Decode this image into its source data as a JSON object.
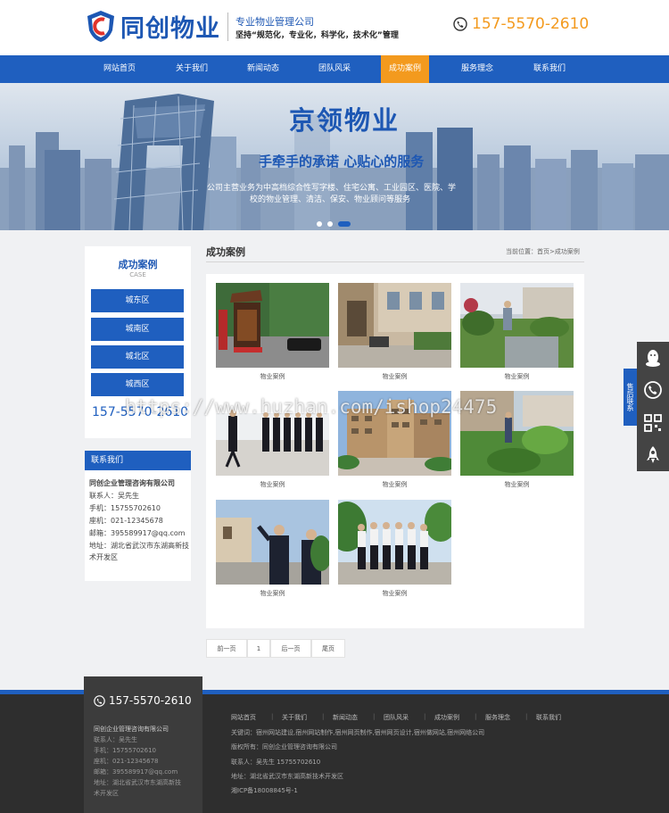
{
  "header": {
    "brand": "同创物业",
    "tagline1": "专业物业管理公司",
    "tagline2": "坚持“规范化，专业化，科学化，技术化”管理",
    "phone": "157-5570-2610",
    "colors": {
      "brand": "#1d57b3",
      "accent": "#f39a1e"
    }
  },
  "nav": {
    "items": [
      {
        "label": "网站首页"
      },
      {
        "label": "关于我们"
      },
      {
        "label": "新闻动态"
      },
      {
        "label": "团队风采"
      },
      {
        "label": "成功案例",
        "active": true
      },
      {
        "label": "服务理念"
      },
      {
        "label": "联系我们"
      }
    ]
  },
  "banner": {
    "title": "京领物业",
    "slogan": "手牵手的承诺   心贴心的服务",
    "desc1": "公司主营业务为中高档综合性写字楼、住宅公寓、工业园区、医院、学",
    "desc2": "校的物业管理、清洁、保安、物业顾问等服务"
  },
  "sidebar": {
    "title": "成功案例",
    "subtitle": "CASE",
    "items": [
      {
        "label": "城东区"
      },
      {
        "label": "城南区"
      },
      {
        "label": "城北区"
      },
      {
        "label": "城西区"
      }
    ],
    "phone": "157-5570-2610"
  },
  "contact": {
    "title": "联系我们",
    "company": "同创企业管理咨询有限公司",
    "person": "联系人：吴先生",
    "mobile": "手机：15755702610",
    "tel": "座机：021-12345678",
    "email": "邮箱：395589917@qq.com",
    "address1": "地址：湖北省武汉市东湖高新技",
    "address2": "术开发区"
  },
  "main": {
    "title": "成功案例",
    "breadcrumb": "当前位置：首页>成功案例",
    "cases": [
      {
        "caption": "物业案例",
        "icon": "pavilion-photo"
      },
      {
        "caption": "物业案例",
        "icon": "building-entrance-photo"
      },
      {
        "caption": "物业案例",
        "icon": "gardener-photo"
      },
      {
        "caption": "物业案例",
        "icon": "guards-lineup-photo"
      },
      {
        "caption": "物业案例",
        "icon": "residential-complex-photo"
      },
      {
        "caption": "物业案例",
        "icon": "garden-worker-photo"
      },
      {
        "caption": "物业案例",
        "icon": "guards-saluting-photo"
      },
      {
        "caption": "物业案例",
        "icon": "guards-parade-photo"
      }
    ],
    "pagination": {
      "prev": "前一页",
      "current": "1",
      "next": "后一页",
      "last": "尾页"
    }
  },
  "watermark": "https://www.huzhan.com/ishop24475",
  "float": {
    "tab": "售后联系",
    "icons": [
      "qq-icon",
      "phone-icon",
      "qrcode-icon",
      "rocket-icon"
    ]
  },
  "footer": {
    "phone": "157-5570-2610",
    "company": "同创企业管理咨询有限公司",
    "person": "联系人：吴先生",
    "mobile": "手机：15755702610",
    "tel": "座机：021-12345678",
    "email": "邮箱：395589917@qq.com",
    "address1": "地址：湖北省武汉市东湖高新技",
    "address2": "术开发区",
    "nav": [
      {
        "label": "网站首页"
      },
      {
        "label": "关于我们"
      },
      {
        "label": "新闻动态"
      },
      {
        "label": "团队风采"
      },
      {
        "label": "成功案例"
      },
      {
        "label": "服务理念"
      },
      {
        "label": "联系我们"
      }
    ],
    "keywords": "关键词：宿州网站建设,宿州网站制作,宿州网页制作,宿州网页设计,宿州做网站,宿州网络公司",
    "copyright": "版权所有：同创企业管理咨询有限公司",
    "contact": "联系人：吴先生 15755702610",
    "address": "地址：湖北省武汉市东湖高新技术开发区",
    "icp": "湘ICP备18008845号-1"
  }
}
